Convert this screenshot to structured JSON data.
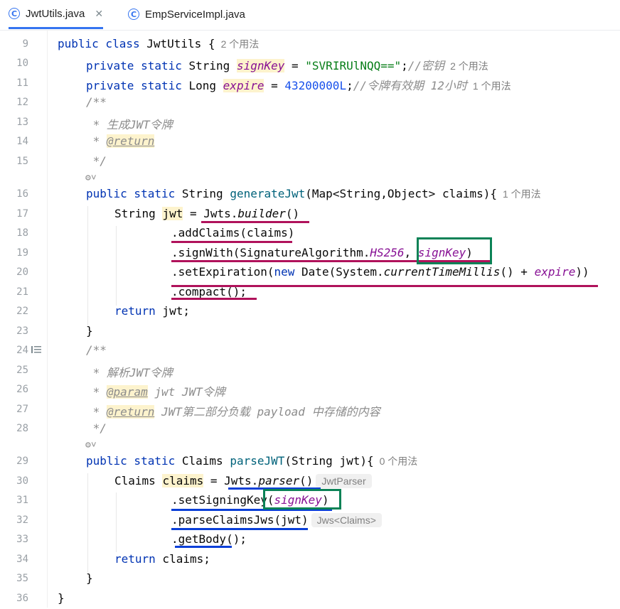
{
  "tabs": [
    {
      "label": "JwtUtils.java",
      "active": true,
      "close": "✕"
    },
    {
      "label": "EmpServiceImpl.java",
      "active": false
    }
  ],
  "lines": {
    "l9": {
      "n": "9",
      "kw": "public class",
      "name": "JwtUtils {",
      "hint": "2 个用法"
    },
    "l10": {
      "n": "10",
      "kw": "private static",
      "type": "String",
      "field": "signKey",
      "eq": " = ",
      "str": "\"SVRIRUlNQQ==\"",
      "semi": ";",
      "cmt": "//密钥",
      "hint": "2 个用法"
    },
    "l11": {
      "n": "11",
      "kw": "private static",
      "type": "Long",
      "field": "expire",
      "eq": " = ",
      "num": "43200000L",
      "semi": ";",
      "cmt": "//令牌有效期 12小时",
      "hint": "1 个用法"
    },
    "l12": {
      "n": "12",
      "cmt": "/**"
    },
    "l13": {
      "n": "13",
      "cmt": " * 生成JWT令牌"
    },
    "l14": {
      "n": "14",
      "cmt": " * ",
      "tag": "@return"
    },
    "l15": {
      "n": "15",
      "cmt": " */"
    },
    "l16": {
      "n": "16",
      "kw": "public static",
      "type": "String",
      "method": "generateJwt",
      "rest": "(Map<String,Object> claims){",
      "hint": "1 个用法"
    },
    "l17": {
      "n": "17",
      "type": "String",
      "var": "jwt",
      "eq": " = ",
      "cls": "Jwts.",
      "smethod": "builder",
      "rest": "()"
    },
    "l18": {
      "n": "18",
      "text": ".addClaims(claims)"
    },
    "l19": {
      "n": "19",
      "text": ".signWith(SignatureAlgorithm.",
      "enum": "HS256",
      "comma": ", ",
      "field": "signKey",
      "close": ")"
    },
    "l20": {
      "n": "20",
      "text": ".setExpiration(",
      "kw": "new",
      "text2": " Date(System.",
      "smethod": "currentTimeMillis",
      "text3": "() + ",
      "field": "expire",
      "close": "))"
    },
    "l21": {
      "n": "21",
      "text": ".compact();"
    },
    "l22": {
      "n": "22",
      "kw": "return",
      "text": " jwt;"
    },
    "l23": {
      "n": "23",
      "text": "}"
    },
    "l24": {
      "n": "24",
      "cmt": "/**"
    },
    "l25": {
      "n": "25",
      "cmt": " * 解析JWT令牌"
    },
    "l26": {
      "n": "26",
      "cmt": " * ",
      "tag": "@param",
      "cmt2": " jwt JWT令牌"
    },
    "l27": {
      "n": "27",
      "cmt": " * ",
      "tag": "@return",
      "cmt2": " JWT第二部分负载 payload 中存储的内容"
    },
    "l28": {
      "n": "28",
      "cmt": " */"
    },
    "l29": {
      "n": "29",
      "kw": "public static",
      "type": "Claims",
      "method": "parseJWT",
      "rest": "(String jwt){",
      "hint": "0 个用法"
    },
    "l30": {
      "n": "30",
      "type": "Claims",
      "var": "claims",
      "eq": " = ",
      "cls": "Jwts.",
      "smethod": "parser",
      "rest": "()",
      "inlay": "JwtParser"
    },
    "l31": {
      "n": "31",
      "text": ".setSigningKey(",
      "field": "signKey",
      "close": ")"
    },
    "l32": {
      "n": "32",
      "text": ".parseClaimsJws(jwt)",
      "inlay": "Jws<Claims>"
    },
    "l33": {
      "n": "33",
      "text": ".getBody();"
    },
    "l34": {
      "n": "34",
      "kw": "return",
      "text": " claims;"
    },
    "l35": {
      "n": "35",
      "text": "}"
    },
    "l36": {
      "n": "36",
      "text": "}"
    }
  },
  "fold_icon": "⚙˅",
  "gutter_icon": "list-icon",
  "colors": {
    "keyword": "#0033b3",
    "field": "#871094",
    "string": "#067d17",
    "number": "#1750eb",
    "comment": "#8c8c8c",
    "red_underline": "#b0125b",
    "blue_underline": "#0a3fd8",
    "green_box": "#0b8256",
    "tab_accent": "#3574f0"
  }
}
